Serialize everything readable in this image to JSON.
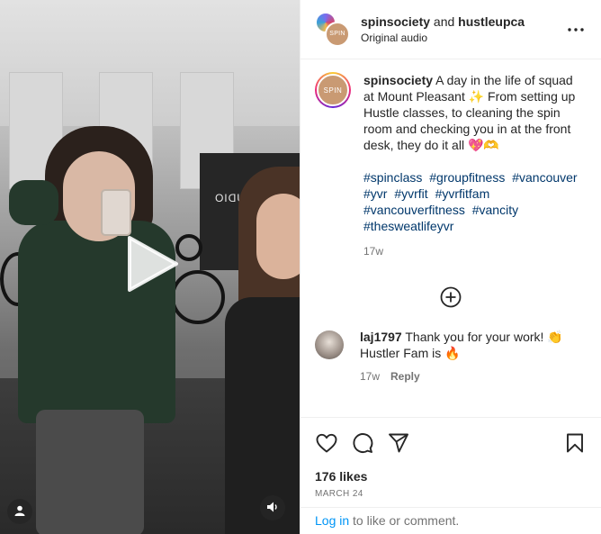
{
  "header": {
    "account1": "spinsociety",
    "and_text": "and",
    "account2": "hustleupca",
    "subtitle": "Original audio",
    "avatar_text": "SPIN"
  },
  "caption": {
    "user": "spinsociety",
    "text": "A day in the life of squad at Mount Pleasant ✨ From setting up Hustle classes, to cleaning the spin room and checking you in at the front desk, they do it all 💖🫶",
    "hashtags": [
      "#spinclass",
      "#groupfitness",
      "#vancouver",
      "#yvr",
      "#yvrfit",
      "#yvrfitfam",
      "#vancouverfitness",
      "#vancity",
      "#thesweatlifeyvr"
    ],
    "time": "17w",
    "avatar_text": "SPIN"
  },
  "comment": {
    "user": "laj1797",
    "text": "Thank you for your work! 👏 Hustler Fam is 🔥",
    "time": "17w",
    "reply_label": "Reply"
  },
  "media": {
    "overlay_text": "STUDIO"
  },
  "engagement": {
    "likes": "176 likes",
    "date": "MARCH 24"
  },
  "footer": {
    "login_link": "Log in",
    "login_text": "to like or comment."
  },
  "icons": {
    "like": "heart-icon",
    "comment": "comment-icon",
    "share": "share-icon",
    "save": "bookmark-icon",
    "more": "more-icon",
    "play": "play-icon",
    "audio": "audio-icon",
    "load_more": "add-circle-icon",
    "tagged": "user-icon"
  },
  "colors": {
    "link": "#0095f6",
    "hashtag": "#00376b",
    "muted": "#737373"
  }
}
